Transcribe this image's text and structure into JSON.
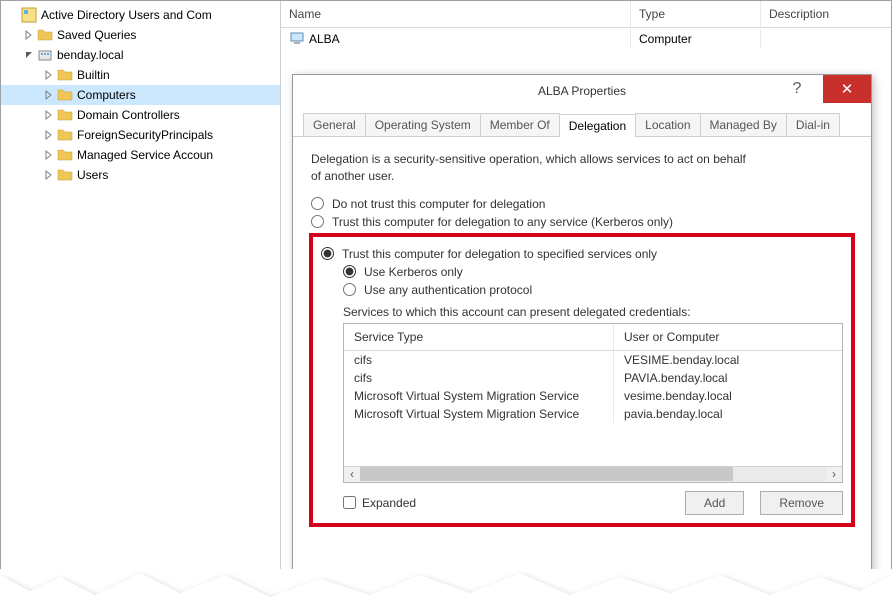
{
  "tree": {
    "root_label": "Active Directory Users and Com",
    "saved_queries": "Saved Queries",
    "domain": "benday.local",
    "nodes": [
      {
        "label": "Builtin"
      },
      {
        "label": "Computers"
      },
      {
        "label": "Domain Controllers"
      },
      {
        "label": "ForeignSecurityPrincipals"
      },
      {
        "label": "Managed Service Accoun"
      },
      {
        "label": "Users"
      }
    ]
  },
  "list": {
    "columns": {
      "name": "Name",
      "type": "Type",
      "desc": "Description"
    },
    "row": {
      "name": "ALBA",
      "type": "Computer"
    }
  },
  "dialog": {
    "title": "ALBA Properties",
    "tabs": [
      "General",
      "Operating System",
      "Member Of",
      "Delegation",
      "Location",
      "Managed By",
      "Dial-in"
    ],
    "active_tab": "Delegation",
    "description": "Delegation is a security-sensitive operation, which allows services to act on behalf of another user.",
    "radios": {
      "r1": "Do not trust this computer for delegation",
      "r2": "Trust this computer for delegation to any service (Kerberos only)",
      "r3": "Trust this computer for delegation to specified services only",
      "r3a": "Use Kerberos only",
      "r3b": "Use any authentication protocol"
    },
    "services_label": "Services to which this account can present delegated credentials:",
    "svc_columns": {
      "type": "Service Type",
      "target": "User or Computer"
    },
    "services": [
      {
        "type": "cifs",
        "target": "VESIME.benday.local"
      },
      {
        "type": "cifs",
        "target": "PAVIA.benday.local"
      },
      {
        "type": "Microsoft Virtual System Migration Service",
        "target": "vesime.benday.local"
      },
      {
        "type": "Microsoft Virtual System Migration Service",
        "target": "pavia.benday.local"
      }
    ],
    "expanded": "Expanded",
    "add": "Add",
    "remove": "Remove"
  }
}
